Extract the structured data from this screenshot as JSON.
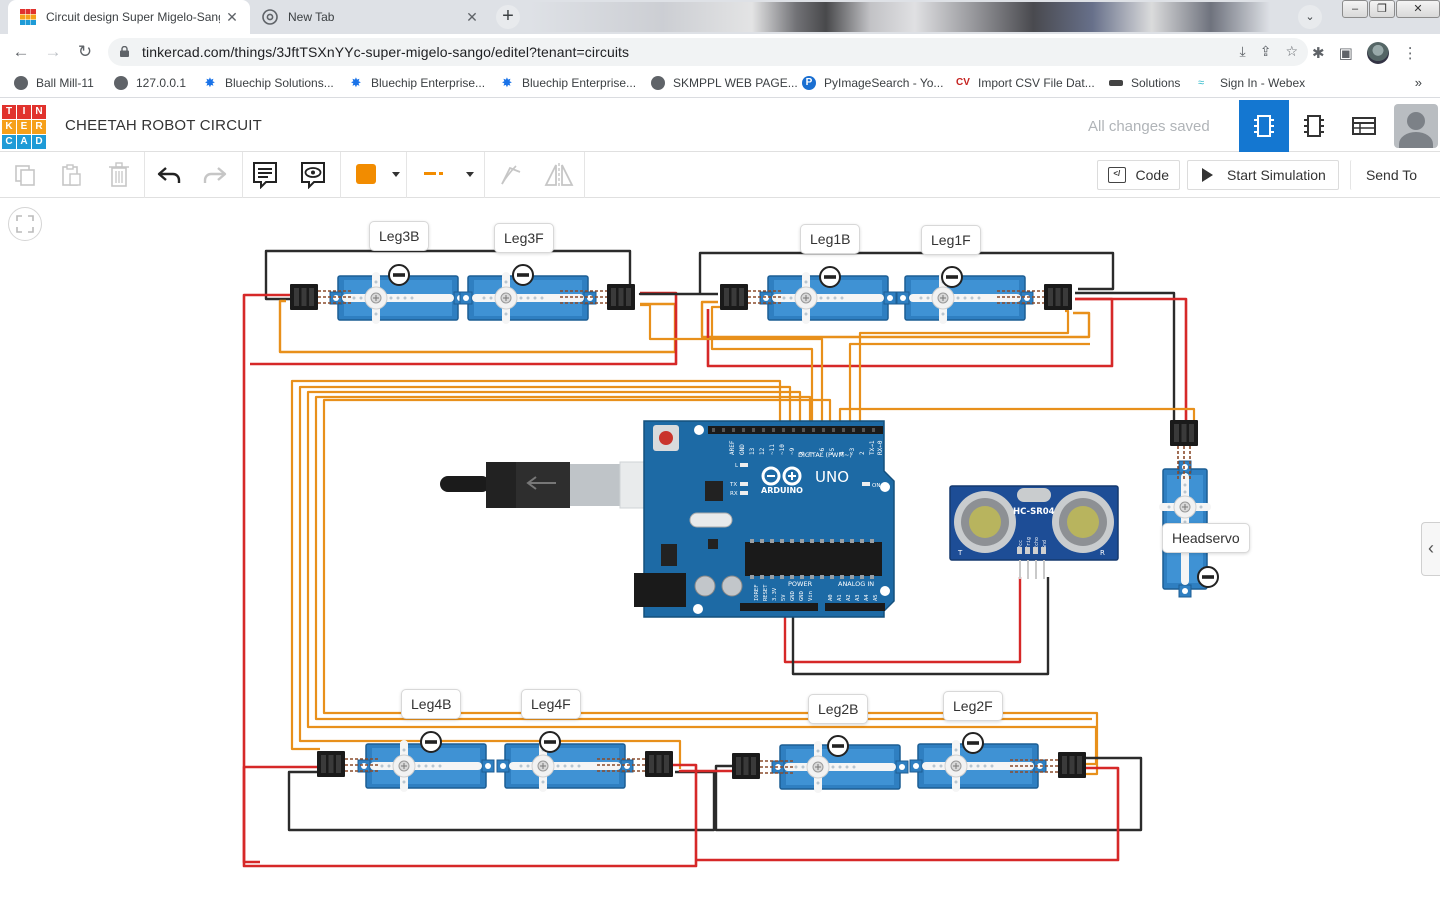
{
  "browser": {
    "tabs": [
      {
        "title": "Circuit design Super Migelo-Sango",
        "icon": "tinkercad-favicon"
      },
      {
        "title": "New Tab",
        "icon": "chrome-icon"
      }
    ],
    "url": "tinkercad.com/things/3JftTSXnYYc-super-migelo-sango/editel?tenant=circuits",
    "bookmarks": [
      {
        "label": "Ball Mill-11",
        "icon": "globe"
      },
      {
        "label": "127.0.0.1",
        "icon": "globe"
      },
      {
        "label": "Bluechip Solutions...",
        "icon": "sparkle"
      },
      {
        "label": "Bluechip Enterprise...",
        "icon": "sparkle"
      },
      {
        "label": "Bluechip Enterprise...",
        "icon": "sparkle"
      },
      {
        "label": "SKMPPL WEB PAGE...",
        "icon": "globe"
      },
      {
        "label": "PyImageSearch - Yo...",
        "icon": "pyimagesearch"
      },
      {
        "label": "Import CSV File Dat...",
        "icon": "cv"
      },
      {
        "label": "Solutions",
        "icon": "bar"
      },
      {
        "label": "Sign In - Webex",
        "icon": "webex"
      }
    ],
    "more_bookmarks": "»"
  },
  "app": {
    "logo_letters": [
      "T",
      "I",
      "N",
      "K",
      "E",
      "R",
      "C",
      "A",
      "D"
    ],
    "logo_colors": [
      "#e1322d",
      "#e1322d",
      "#e1322d",
      "#f6a01a",
      "#f6a01a",
      "#f6a01a",
      "#1e9bd7",
      "#1e9bd7",
      "#1e9bd7"
    ],
    "design_title": "CHEETAH ROBOT CIRCUIT",
    "save_status": "All changes saved",
    "accent_color": "#1477d1"
  },
  "toolbar": {
    "code_label": "Code",
    "code_icon_text": "</",
    "simulation_label": "Start Simulation",
    "send_to_label": "Send To",
    "wire_color": "#f28c00"
  },
  "canvas": {
    "labels": {
      "leg3b": "Leg3B",
      "leg3f": "Leg3F",
      "leg1b": "Leg1B",
      "leg1f": "Leg1F",
      "leg4b": "Leg4B",
      "leg4f": "Leg4F",
      "leg2b": "Leg2B",
      "leg2f": "Leg2F",
      "headservo": "Headservo"
    },
    "arduino": {
      "brand": "ARDUINO",
      "model": "UNO",
      "digital_label": "DIGITAL (PWM~)",
      "power_label": "POWER",
      "analog_label": "ANALOG IN",
      "on_label": "ON",
      "l_label": "L",
      "tx_label": "TX",
      "rx_label": "RX",
      "digital_pins": [
        "AREF",
        "GND",
        "13",
        "12",
        "~11",
        "~10",
        "~9",
        "8",
        "7",
        "~6",
        "~5",
        "4",
        "~3",
        "2",
        "TX→1",
        "RX←0"
      ],
      "power_pins": [
        "IOREF",
        "RESET",
        "3.3V",
        "5V",
        "GND",
        "GND",
        "Vin"
      ],
      "analog_pins": [
        "A0",
        "A1",
        "A2",
        "A3",
        "A4",
        "A5"
      ]
    },
    "sensor": {
      "model": "HC-SR04",
      "pins": [
        "Vcc",
        "Trig",
        "Echo",
        "Gnd"
      ],
      "corner_left": "T",
      "corner_right": "R"
    },
    "wire_colors": {
      "signal": "#e8901b",
      "power": "#d62828",
      "ground": "#2b2b2b"
    }
  }
}
